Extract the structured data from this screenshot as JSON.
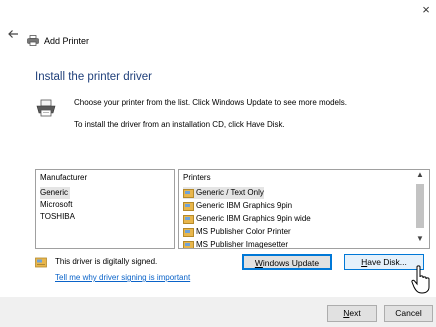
{
  "window": {
    "close_glyph": "×"
  },
  "header": {
    "back_icon": "back-arrow-icon",
    "title": "Add Printer",
    "title_icon": "printer-icon"
  },
  "main": {
    "heading": "Install the printer driver",
    "instruction_1": "Choose your printer from the list. Click Windows Update to see more models.",
    "instruction_2": "To install the driver from an installation CD, click Have Disk."
  },
  "manufacturer": {
    "header": "Manufacturer",
    "items": [
      "Generic",
      "Microsoft",
      "TOSHIBA"
    ],
    "selected": "Generic"
  },
  "printers": {
    "header": "Printers",
    "items": [
      "Generic / Text Only",
      "Generic IBM Graphics 9pin",
      "Generic IBM Graphics 9pin wide",
      "MS Publisher Color Printer",
      "MS Publisher Imagesetter"
    ],
    "selected": "Generic / Text Only"
  },
  "driver_info": {
    "signed_text": "This driver is digitally signed.",
    "link_text": "Tell me why driver signing is important"
  },
  "buttons": {
    "windows_update": {
      "accel": "W",
      "rest": "indows Update"
    },
    "have_disk": {
      "accel": "H",
      "rest": "ave Disk..."
    },
    "next": {
      "accel": "N",
      "rest": "ext"
    },
    "cancel": "Cancel"
  },
  "colors": {
    "accent": "#0078d7",
    "heading": "#1f3f7a",
    "link": "#0a63c9"
  }
}
